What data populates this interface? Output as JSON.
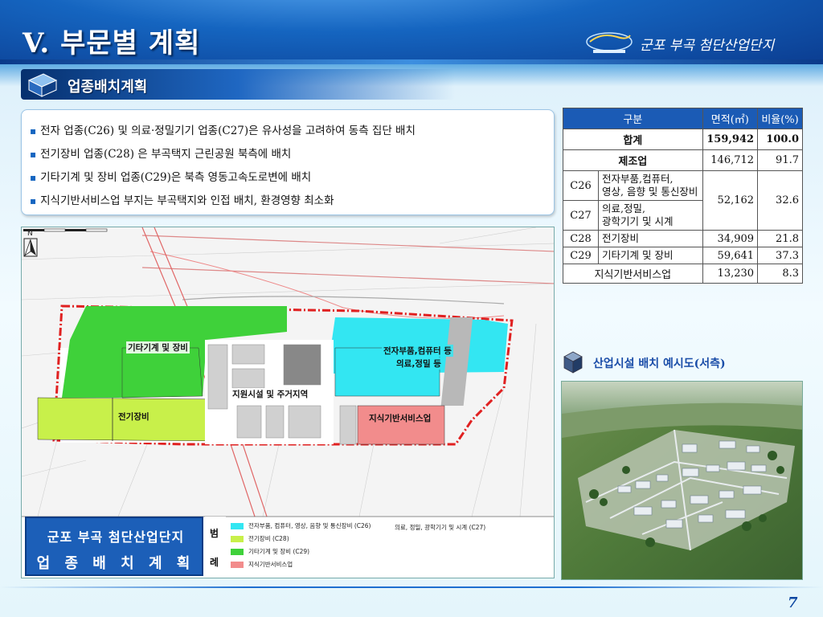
{
  "header": {
    "title": "V. 부문별 계획",
    "complex_name": "군포 부곡 첨단산업단지",
    "subtitle": "업종배치계획"
  },
  "bullets": [
    "전자 업종(C26) 및 의료·정밀기기 업종(C27)은 유사성을 고려하여 동측 집단 배치",
    "전기장비 업종(C28) 은 부곡택지 근린공원 북측에 배치",
    "기타기계 및 장비 업종(C29)은 북측 영동고속도로변에 배치",
    "지식기반서비스업 부지는 부곡택지와 인접 배치, 환경영향 최소화"
  ],
  "table": {
    "headers": [
      "구분",
      "면적(㎡)",
      "비율(%)"
    ],
    "total": {
      "label": "합계",
      "area": "159,942",
      "ratio": "100.0"
    },
    "manufacturing": {
      "label": "제조업",
      "area": "146,712",
      "ratio": "91.7"
    },
    "c26": {
      "code": "C26",
      "desc": "전자부품,컴퓨터,\n영상, 음향 및 통신장비"
    },
    "c27": {
      "code": "C27",
      "desc": "의료,정밀,\n광학기기 및 시계"
    },
    "c26_c27": {
      "area": "52,162",
      "ratio": "32.6"
    },
    "c28": {
      "code": "C28",
      "desc": "전기장비",
      "area": "34,909",
      "ratio": "21.8"
    },
    "c29": {
      "code": "C29",
      "desc": "기타기계 및 장비",
      "area": "59,641",
      "ratio": "37.3"
    },
    "knowledge": {
      "label": "지식기반서비스업",
      "area": "13,230",
      "ratio": "8.3"
    }
  },
  "map": {
    "labels": {
      "machinery": "기타기계 및 장비",
      "electronics": "전자부품,컴퓨터 등",
      "medical": "의료,정밀 등",
      "support": "지원시설 및 주거지역",
      "electrical": "전기장비",
      "knowledge": "지식기반서비스업"
    },
    "title_line1": "군포 부곡 첨단산업단지",
    "title_line2": "업 종 배 치 계 획 도",
    "legend_head": [
      "범",
      "례"
    ],
    "legend": [
      {
        "label": "전자부품, 컴퓨터, 영상, 음향 및 통신장비 (C26)",
        "color": "#33e6f2"
      },
      {
        "label": "전기장비 (C28)",
        "color": "#c8f04a"
      },
      {
        "label": "기타기계 및 장비 (C29)",
        "color": "#3fd13a"
      },
      {
        "label": "지식기반서비스업",
        "color": "#f28c8c"
      }
    ],
    "legend_extra": "의료, 정밀, 광학기기 및 시계 (C27)",
    "north": "N"
  },
  "photo_caption": "산업시설 배치 예시도(서측)",
  "page_number": "7",
  "colors": {
    "c26": "#33e6f2",
    "c28": "#c8f04a",
    "c29": "#3fd13a",
    "knowledge": "#f28c8c",
    "table_header": "#1b5bb5"
  }
}
